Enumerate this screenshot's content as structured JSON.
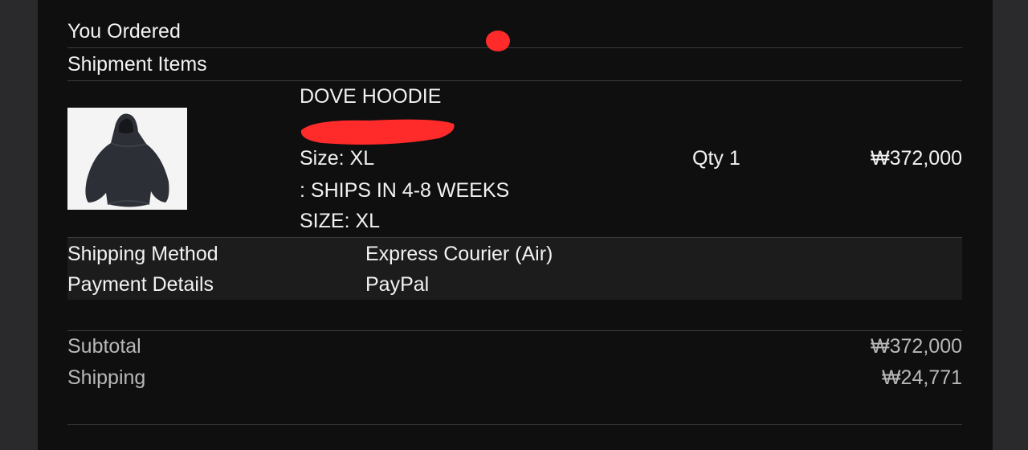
{
  "header": {
    "you_ordered": "You Ordered",
    "shipment_items": "Shipment Items"
  },
  "item": {
    "name": "DOVE HOODIE",
    "size": "Size: XL",
    "ships": ": SHIPS IN 4-8 WEEKS",
    "size_caps": "SIZE: XL",
    "qty": "Qty 1",
    "price": "₩372,000"
  },
  "details": {
    "shipping_method_label": "Shipping Method",
    "shipping_method_value": "Express Courier (Air)",
    "payment_details_label": "Payment Details",
    "payment_details_value": "PayPal"
  },
  "summary": {
    "subtotal_label": "Subtotal",
    "subtotal_value": "₩372,000",
    "shipping_label": "Shipping",
    "shipping_value": "₩24,771"
  },
  "colors": {
    "background": "#0f0f0f",
    "redaction": "#ff2a2a"
  }
}
